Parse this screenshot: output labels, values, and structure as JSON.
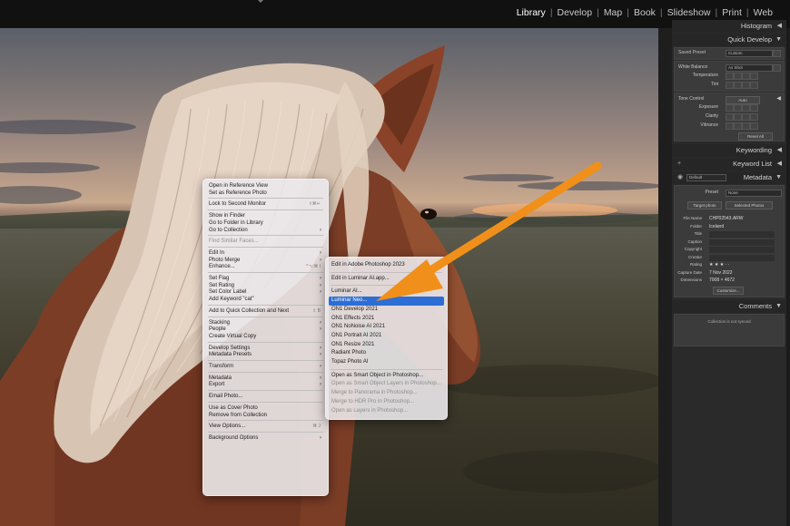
{
  "app": {
    "modules": [
      "Library",
      "Develop",
      "Map",
      "Book",
      "Slideshow",
      "Print",
      "Web"
    ],
    "active_module": "Library"
  },
  "right_panel": {
    "histogram": "Histogram",
    "quick_develop": {
      "title": "Quick Develop",
      "saved_preset_label": "Saved Preset",
      "saved_preset_value": "Custom",
      "white_balance_label": "White Balance",
      "white_balance_value": "As Shot",
      "temperature_label": "Temperature",
      "tint_label": "Tint",
      "tone_control_label": "Tone Control",
      "auto_button": "Auto",
      "exposure_label": "Exposure",
      "clarity_label": "Clarity",
      "vibrance_label": "Vibrance",
      "reset_all_button": "Reset All"
    },
    "keywording": "Keywording",
    "keyword_list": "Keyword List",
    "metadata": {
      "title": "Metadata",
      "preset_dropdown": "Default",
      "preset_label": "Preset",
      "preset_value": "None",
      "target_photo": "Target photo",
      "selected_photos": "Selected Photos",
      "fields": [
        {
          "label": "File Name",
          "value": "CHP02543.ARW"
        },
        {
          "label": "Folder",
          "value": "Iceland"
        },
        {
          "label": "Title",
          "value": ""
        },
        {
          "label": "Caption",
          "value": ""
        },
        {
          "label": "Copyright",
          "value": ""
        },
        {
          "label": "Creator",
          "value": ""
        },
        {
          "label": "Rating",
          "value": "★ ★ ★ · ·"
        },
        {
          "label": "Capture Date",
          "value": "7 Nov 2022"
        },
        {
          "label": "Dimensions",
          "value": "7008 × 4672"
        }
      ],
      "customize_button": "Customize..."
    },
    "comments": {
      "title": "Comments",
      "placeholder": "Collection is not synced"
    }
  },
  "context_menu": {
    "items": [
      {
        "label": "Open in Reference View"
      },
      {
        "label": "Set as Reference Photo"
      },
      {
        "sep": true
      },
      {
        "label": "Lock to Second Monitor",
        "shortcut": "⇧⌘↵"
      },
      {
        "sep": true
      },
      {
        "label": "Show in Finder"
      },
      {
        "label": "Go to Folder in Library"
      },
      {
        "label": "Go to Collection",
        "sub": true
      },
      {
        "sep": true
      },
      {
        "label": "Find Similar Faces...",
        "disabled": true
      },
      {
        "sep": true
      },
      {
        "label": "Edit In",
        "sub": true
      },
      {
        "label": "Photo Merge",
        "sub": true
      },
      {
        "label": "Enhance...",
        "shortcut": "^⌥⌘ I"
      },
      {
        "sep": true
      },
      {
        "label": "Set Flag",
        "sub": true
      },
      {
        "label": "Set Rating",
        "sub": true
      },
      {
        "label": "Set Color Label",
        "sub": true
      },
      {
        "label": "Add Keyword \"cat\""
      },
      {
        "sep": true
      },
      {
        "label": "Add to Quick Collection and Next",
        "shortcut": "⇧ B"
      },
      {
        "sep": true
      },
      {
        "label": "Stacking",
        "sub": true
      },
      {
        "label": "People",
        "sub": true
      },
      {
        "label": "Create Virtual Copy"
      },
      {
        "sep": true
      },
      {
        "label": "Develop Settings",
        "sub": true
      },
      {
        "label": "Metadata Presets",
        "sub": true
      },
      {
        "sep": true
      },
      {
        "label": "Transform",
        "sub": true
      },
      {
        "sep": true
      },
      {
        "label": "Metadata",
        "sub": true
      },
      {
        "label": "Export",
        "sub": true
      },
      {
        "sep": true
      },
      {
        "label": "Email Photo..."
      },
      {
        "sep": true
      },
      {
        "label": "Use as Cover Photo"
      },
      {
        "label": "Remove from Collection"
      },
      {
        "sep": true
      },
      {
        "label": "View Options...",
        "shortcut": "⌘ J"
      },
      {
        "sep": true
      },
      {
        "label": "Background Options",
        "sub": true
      }
    ]
  },
  "submenu": {
    "items": [
      {
        "label": "Edit in Adobe Photoshop 2023"
      },
      {
        "sep": true
      },
      {
        "label": "Edit in Luminar AI.app..."
      },
      {
        "sep": true
      },
      {
        "label": "Luminar AI..."
      },
      {
        "label": "Luminar Neo...",
        "highlighted": true
      },
      {
        "label": "ON1 Develop 2021"
      },
      {
        "label": "ON1 Effects 2021"
      },
      {
        "label": "ON1 NoNoise AI 2021"
      },
      {
        "label": "ON1 Portrait AI 2021"
      },
      {
        "label": "ON1 Resize 2021"
      },
      {
        "label": "Radiant Photo"
      },
      {
        "label": "Topaz Photo AI"
      },
      {
        "sep": true
      },
      {
        "label": "Open as Smart Object in Photoshop..."
      },
      {
        "label": "Open as Smart Object Layers in Photoshop...",
        "disabled": true
      },
      {
        "label": "Merge to Panorama in Photoshop...",
        "disabled": true
      },
      {
        "label": "Merge to HDR Pro in Photoshop...",
        "disabled": true
      },
      {
        "label": "Open as Layers in Photoshop...",
        "disabled": true
      }
    ]
  },
  "colors": {
    "highlight": "#2c6ed6",
    "arrow": "#f0901a"
  }
}
